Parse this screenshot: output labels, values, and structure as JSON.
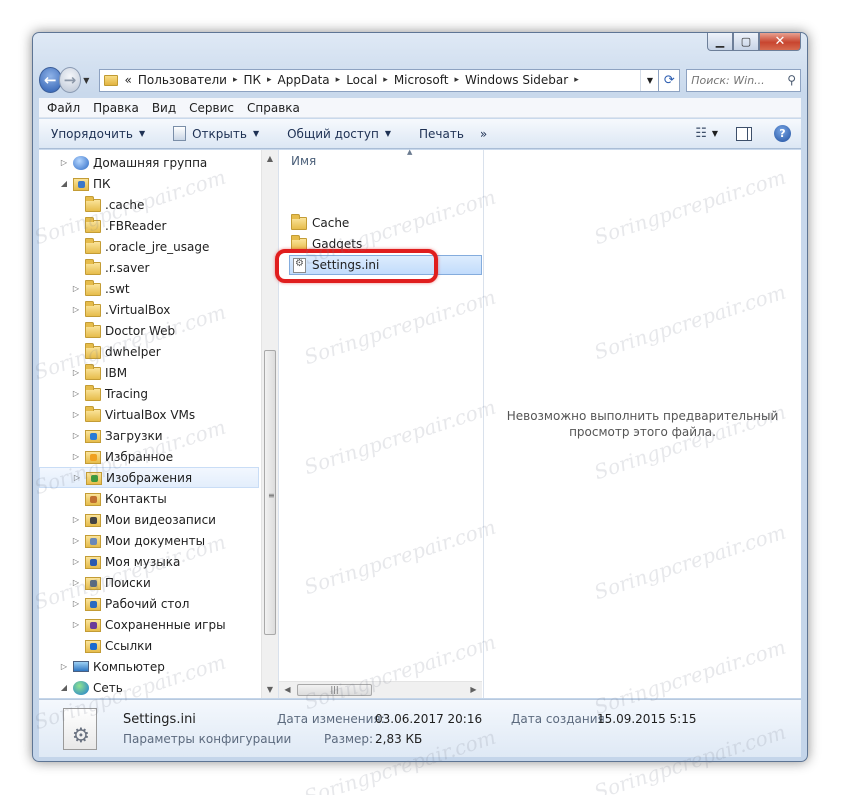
{
  "address": {
    "overflow": "«",
    "crumbs": [
      "Пользователи",
      "ПК",
      "AppData",
      "Local",
      "Microsoft",
      "Windows Sidebar"
    ],
    "search_placeholder": "Поиск: Win..."
  },
  "menu": [
    "Файл",
    "Правка",
    "Вид",
    "Сервис",
    "Справка"
  ],
  "commands": {
    "organize": "Упорядочить",
    "open": "Открыть",
    "share": "Общий доступ",
    "print": "Печать",
    "more": "»"
  },
  "tree": [
    {
      "label": "Домашняя группа",
      "indent": 0,
      "icon": "homegroup",
      "expand": "▷"
    },
    {
      "label": "ПК",
      "indent": 0,
      "icon": "user-folder",
      "expand": "◢"
    },
    {
      "label": ".cache",
      "indent": 1,
      "icon": "folder",
      "expand": ""
    },
    {
      "label": ".FBReader",
      "indent": 1,
      "icon": "folder",
      "expand": ""
    },
    {
      "label": ".oracle_jre_usage",
      "indent": 1,
      "icon": "folder",
      "expand": ""
    },
    {
      "label": ".r.saver",
      "indent": 1,
      "icon": "folder",
      "expand": ""
    },
    {
      "label": ".swt",
      "indent": 1,
      "icon": "folder",
      "expand": "▷"
    },
    {
      "label": ".VirtualBox",
      "indent": 1,
      "icon": "folder",
      "expand": "▷"
    },
    {
      "label": "Doctor Web",
      "indent": 1,
      "icon": "folder",
      "expand": ""
    },
    {
      "label": "dwhelper",
      "indent": 1,
      "icon": "folder",
      "expand": ""
    },
    {
      "label": "IBM",
      "indent": 1,
      "icon": "folder",
      "expand": "▷"
    },
    {
      "label": "Tracing",
      "indent": 1,
      "icon": "folder",
      "expand": "▷"
    },
    {
      "label": "VirtualBox VMs",
      "indent": 1,
      "icon": "folder",
      "expand": "▷"
    },
    {
      "label": "Загрузки",
      "indent": 1,
      "icon": "downloads",
      "expand": "▷"
    },
    {
      "label": "Избранное",
      "indent": 1,
      "icon": "favorites",
      "expand": "▷"
    },
    {
      "label": "Изображения",
      "indent": 1,
      "icon": "pictures",
      "expand": "▷",
      "selected": true
    },
    {
      "label": "Контакты",
      "indent": 1,
      "icon": "contacts",
      "expand": ""
    },
    {
      "label": "Мои видеозаписи",
      "indent": 1,
      "icon": "videos",
      "expand": "▷"
    },
    {
      "label": "Мои документы",
      "indent": 1,
      "icon": "documents",
      "expand": "▷"
    },
    {
      "label": "Моя музыка",
      "indent": 1,
      "icon": "music",
      "expand": "▷"
    },
    {
      "label": "Поиски",
      "indent": 1,
      "icon": "searches",
      "expand": "▷"
    },
    {
      "label": "Рабочий стол",
      "indent": 1,
      "icon": "desktop",
      "expand": "▷"
    },
    {
      "label": "Сохраненные игры",
      "indent": 1,
      "icon": "saved-games",
      "expand": "▷"
    },
    {
      "label": "Ссылки",
      "indent": 1,
      "icon": "links",
      "expand": ""
    },
    {
      "label": "Компьютер",
      "indent": 0,
      "icon": "computer",
      "expand": "▷"
    },
    {
      "label": "Сеть",
      "indent": 0,
      "icon": "network",
      "expand": "◢"
    }
  ],
  "files": {
    "column": "Имя",
    "items": [
      {
        "name": "Cache",
        "type": "folder"
      },
      {
        "name": "Gadgets",
        "type": "folder"
      },
      {
        "name": "Settings.ini",
        "type": "ini",
        "selected": true
      }
    ]
  },
  "preview": {
    "message": "Невозможно выполнить предварительный просмотр этого файла."
  },
  "details": {
    "filename": "Settings.ini",
    "filetype": "Параметры конфигурации",
    "modified_label": "Дата изменения:",
    "modified_value": "03.06.2017 20:16",
    "created_label": "Дата создания:",
    "created_value": "15.09.2015 5:15",
    "size_label": "Размер:",
    "size_value": "2,83 КБ"
  },
  "watermark": "Soringpcrepair.com"
}
